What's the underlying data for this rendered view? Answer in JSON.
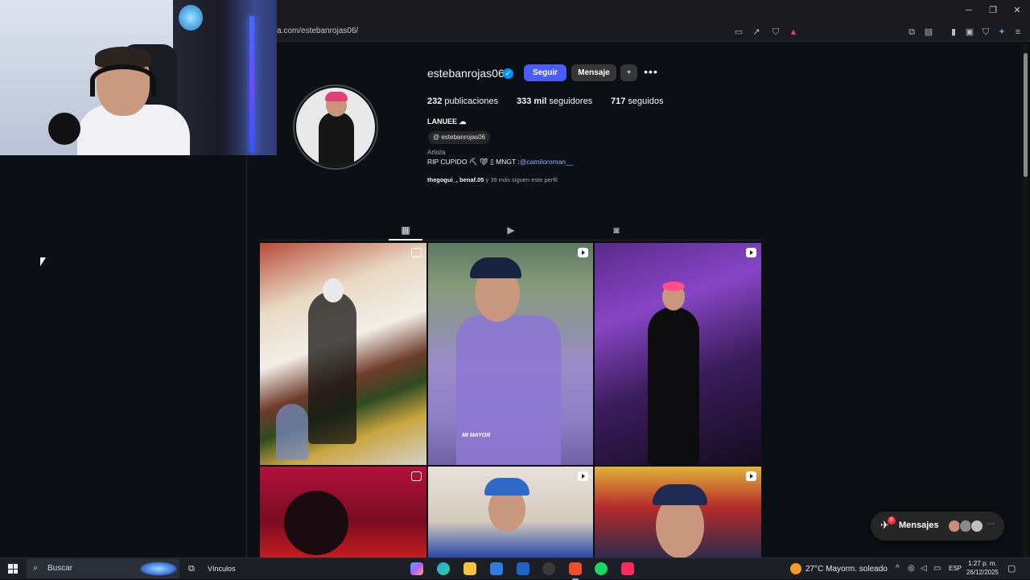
{
  "browser": {
    "url": "a.com/estebanrojas06/",
    "window_controls": {
      "minimize": "─",
      "maximize": "❐",
      "close": "✕"
    }
  },
  "profile": {
    "username": "estebanrojas06",
    "follow_label": "Seguir",
    "message_label": "Mensaje",
    "suggest_icon": "person-plus-icon",
    "more_icon": "•••",
    "stats": {
      "posts_count": "232",
      "posts_label": "publicaciones",
      "followers_count": "333 mil",
      "followers_label": "seguidores",
      "following_count": "717",
      "following_label": "seguidos"
    },
    "full_name": "LANUEE ☁",
    "threads_handle": "estebanrojas06",
    "category": "Artista",
    "bio_text": "RIP CUPIDO ⛏ ❤ ▯ MNGT :",
    "bio_link": "@camiloroman__",
    "followed_by_names": "thegogui_, benaf.05",
    "followed_by_rest": " y 39 más siguen este perfil"
  },
  "tabs": [
    {
      "name": "posts",
      "icon": "grid-icon",
      "active": true
    },
    {
      "name": "reels",
      "icon": "reels-icon",
      "active": false
    },
    {
      "name": "tagged",
      "icon": "tagged-icon",
      "active": false
    }
  ],
  "posts": [
    {
      "type": "multi"
    },
    {
      "type": "reel",
      "caption": "MI MAYOR"
    },
    {
      "type": "reel"
    },
    {
      "type": "multi"
    },
    {
      "type": "reel"
    },
    {
      "type": "reel"
    }
  ],
  "messages": {
    "label": "Mensajes",
    "badge": "6"
  },
  "taskbar": {
    "search_placeholder": "Buscar",
    "vinculos": "Vínculos",
    "weather": "27°C  Mayorm. soleado",
    "language": "ESP",
    "time": "1:27 p. m.",
    "date": "26/12/2025"
  },
  "colors": {
    "follow_button": "#4a5df9",
    "verified": "#0095f6",
    "badge": "#ff3040",
    "page_bg": "#0c1014"
  }
}
